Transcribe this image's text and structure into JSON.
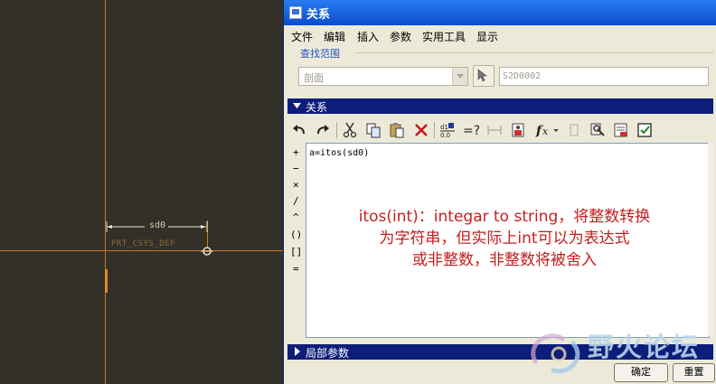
{
  "viewport": {
    "dimension_label": "sd0",
    "csys_label": "PRT_CSYS_DEF",
    "colors": {
      "background": "#333029",
      "datum_line": "#c77a1d"
    }
  },
  "dialog": {
    "title": "关系",
    "menu": [
      "文件",
      "编辑",
      "插入",
      "参数",
      "实用工具",
      "显示"
    ],
    "lookin": {
      "group_label": "查找范围",
      "type_value": "剖面",
      "selection_value": "S2D0002"
    },
    "relations_section": {
      "label": "关系",
      "toolbar_icons": [
        "undo-icon",
        "redo-icon",
        "cut-icon",
        "copy-icon",
        "paste-icon",
        "delete-icon",
        "evaluate-icon",
        "verify-equals-icon",
        "dimension-icon",
        "units-icon",
        "function-icon",
        "parameter-icon",
        "sort-icon",
        "show-dimension-icon",
        "verify-icon"
      ],
      "function_label": "fx",
      "operators": [
        "+",
        "−",
        "×",
        "/",
        "^",
        "()",
        "[]",
        "="
      ],
      "editor_text": "a=itos(sd0)"
    },
    "annotation_lines": [
      "itos(int)：integar to string，将整数转换",
      "为字符串，但实际上int可以为表达式",
      "或非整数，非整数将被舍入"
    ],
    "local_params_label": "局部参数",
    "buttons": {
      "ok": "确定",
      "reset": "重置"
    }
  },
  "watermark": {
    "text": "野火论坛"
  },
  "colors": {
    "title_bar": "#0a4ccc",
    "section_bar": "#0d1e7a",
    "dialog_bg": "#ece9d8",
    "annotation": "#c41e1e"
  }
}
